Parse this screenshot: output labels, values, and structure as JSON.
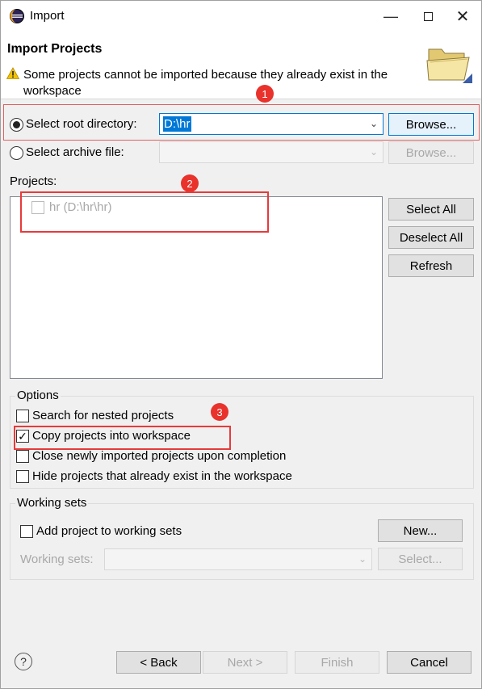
{
  "window": {
    "title": "Import"
  },
  "banner": {
    "title": "Import Projects",
    "message": "Some projects cannot be imported because they already exist in the workspace"
  },
  "source": {
    "root_label": "Select root directory:",
    "root_value": "D:\\hr",
    "root_selected": true,
    "archive_label": "Select archive file:",
    "archive_value": "",
    "browse_label": "Browse...",
    "browse_disabled_label": "Browse..."
  },
  "projects": {
    "label": "Projects:",
    "items": [
      {
        "label": "hr (D:\\hr\\hr)",
        "checked": false,
        "disabled": true
      }
    ],
    "select_all": "Select All",
    "deselect_all": "Deselect All",
    "refresh": "Refresh"
  },
  "options": {
    "title": "Options",
    "items": [
      {
        "label": "Search for nested projects",
        "checked": false
      },
      {
        "label": "Copy projects into workspace",
        "checked": true
      },
      {
        "label": "Close newly imported projects upon completion",
        "checked": false
      },
      {
        "label": "Hide projects that already exist in the workspace",
        "checked": false
      }
    ]
  },
  "working_sets": {
    "title": "Working sets",
    "add_label": "Add project to working sets",
    "new_button": "New...",
    "sets_label": "Working sets:",
    "sets_value": "",
    "select_button": "Select..."
  },
  "footer": {
    "back": "< Back",
    "next": "Next >",
    "finish": "Finish",
    "cancel": "Cancel"
  },
  "callouts": [
    "1",
    "2",
    "3"
  ],
  "colors": {
    "accent": "#0078d7",
    "callout_red": "#e8322b",
    "disabled_text": "#a8a8a8"
  }
}
